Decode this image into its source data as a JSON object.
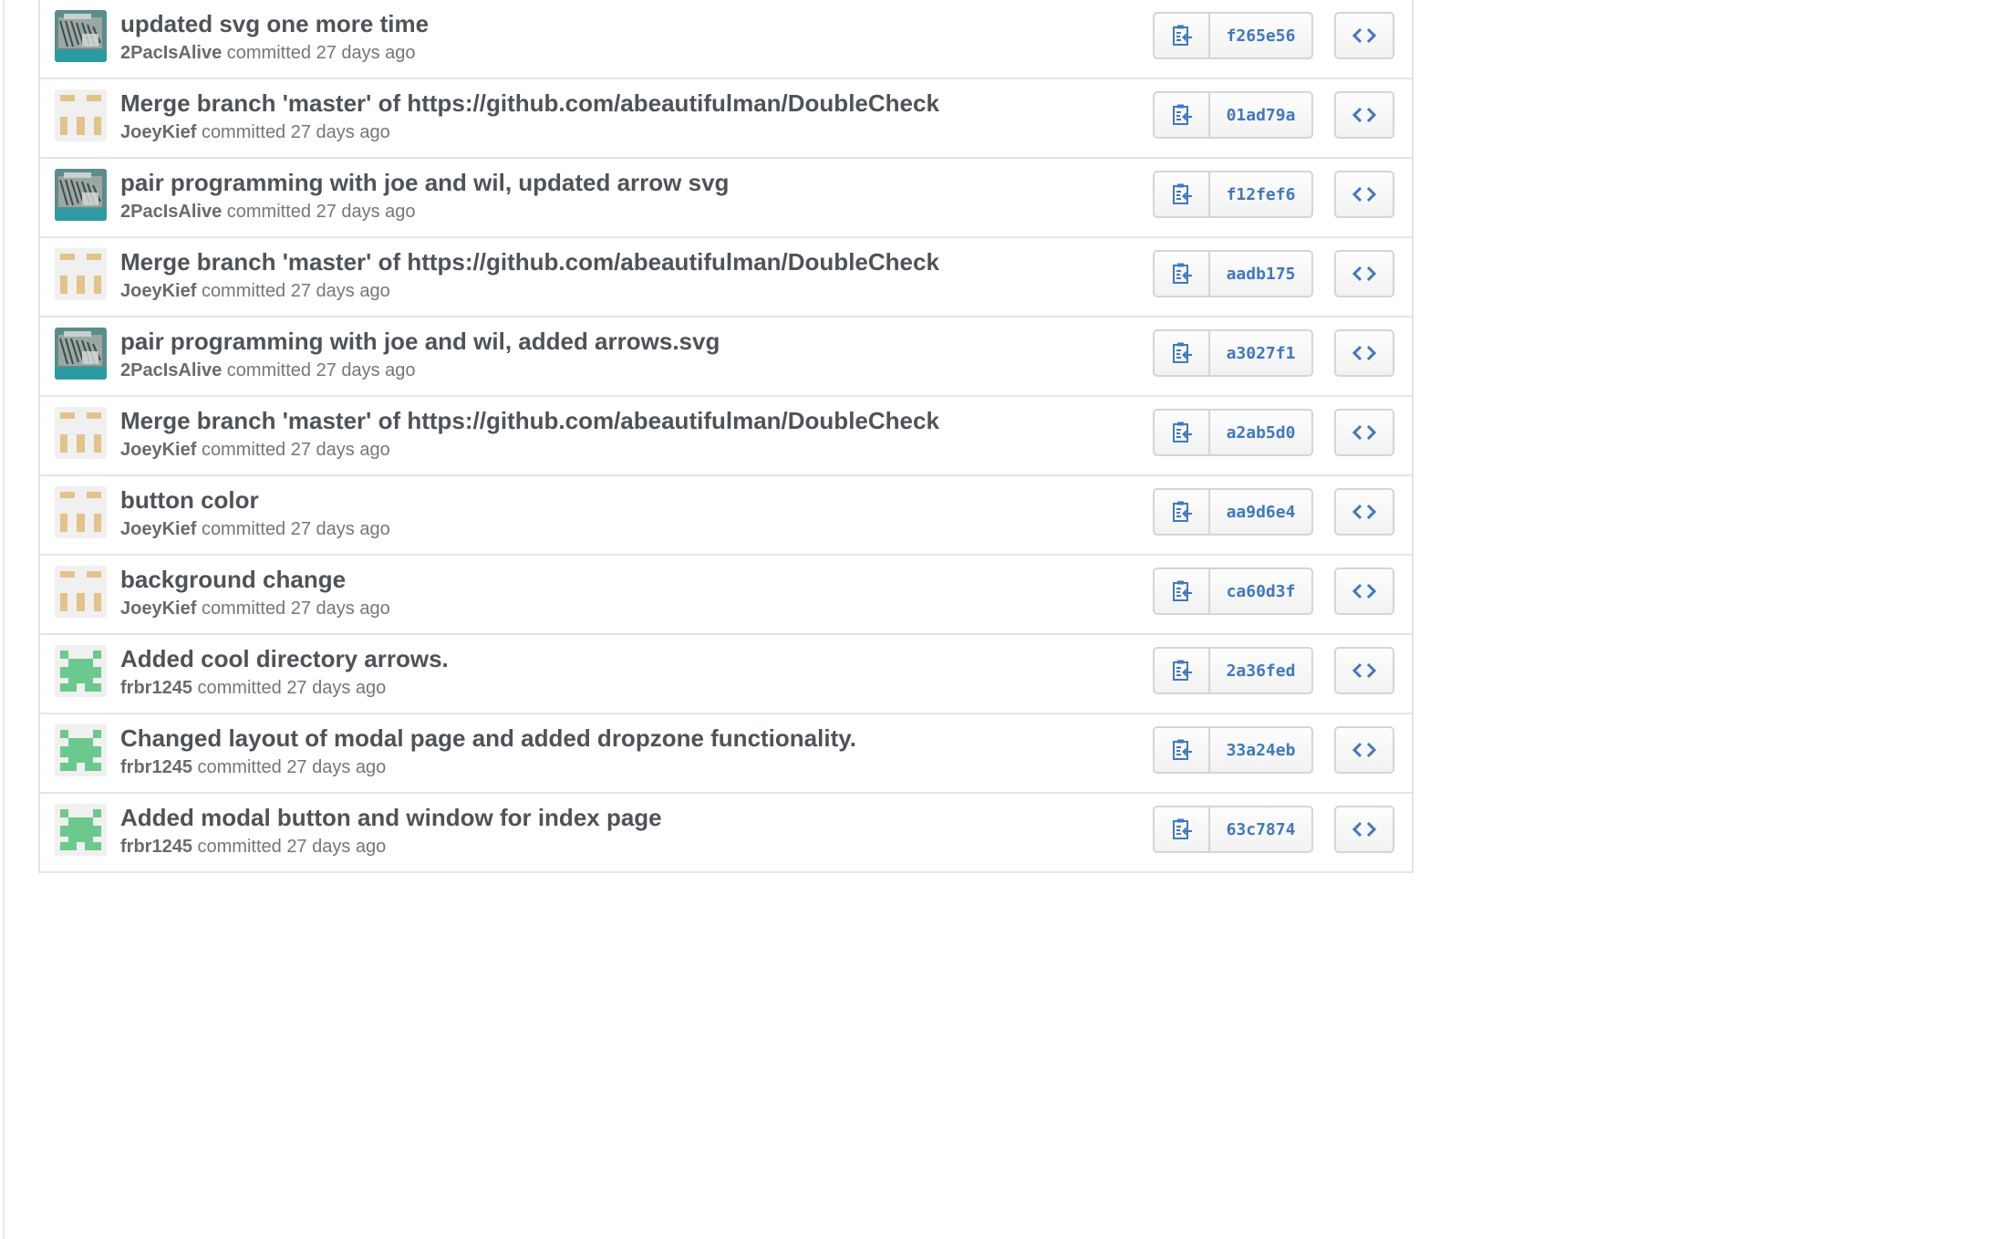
{
  "commits": [
    {
      "message": "updated svg one more time",
      "author": "2PacIsAlive",
      "action": "committed",
      "time": "27 days ago",
      "sha": "f265e56",
      "avatar": "photo-avatar"
    },
    {
      "message": "Merge branch 'master' of https://github.com/abeautifulman/DoubleCheck",
      "author": "JoeyKief",
      "action": "committed",
      "time": "27 days ago",
      "sha": "01ad79a",
      "avatar": "identicon-tan"
    },
    {
      "message": "pair programming with joe and wil, updated arrow svg",
      "author": "2PacIsAlive",
      "action": "committed",
      "time": "27 days ago",
      "sha": "f12fef6",
      "avatar": "photo-avatar"
    },
    {
      "message": "Merge branch 'master' of https://github.com/abeautifulman/DoubleCheck",
      "author": "JoeyKief",
      "action": "committed",
      "time": "27 days ago",
      "sha": "aadb175",
      "avatar": "identicon-tan"
    },
    {
      "message": "pair programming with joe and wil, added arrows.svg",
      "author": "2PacIsAlive",
      "action": "committed",
      "time": "27 days ago",
      "sha": "a3027f1",
      "avatar": "photo-avatar"
    },
    {
      "message": "Merge branch 'master' of https://github.com/abeautifulman/DoubleCheck",
      "author": "JoeyKief",
      "action": "committed",
      "time": "27 days ago",
      "sha": "a2ab5d0",
      "avatar": "identicon-tan"
    },
    {
      "message": "button color",
      "author": "JoeyKief",
      "action": "committed",
      "time": "27 days ago",
      "sha": "aa9d6e4",
      "avatar": "identicon-tan"
    },
    {
      "message": "background change",
      "author": "JoeyKief",
      "action": "committed",
      "time": "27 days ago",
      "sha": "ca60d3f",
      "avatar": "identicon-tan"
    },
    {
      "message": "Added cool directory arrows.",
      "author": "frbr1245",
      "action": "committed",
      "time": "27 days ago",
      "sha": "2a36fed",
      "avatar": "identicon-green"
    },
    {
      "message": "Changed layout of modal page and added dropzone functionality.",
      "author": "frbr1245",
      "action": "committed",
      "time": "27 days ago",
      "sha": "33a24eb",
      "avatar": "identicon-green"
    },
    {
      "message": "Added modal button and window for index page",
      "author": "frbr1245",
      "action": "committed",
      "time": "27 days ago",
      "sha": "63c7874",
      "avatar": "identicon-green"
    }
  ],
  "icons": {
    "copy": "clipboard-copy-icon",
    "browse": "code-icon"
  },
  "colors": {
    "sha_link": "#4078c0",
    "identicon_tan": "#e2c38a",
    "identicon_green": "#6cc98d",
    "border": "#e5e5e5"
  }
}
